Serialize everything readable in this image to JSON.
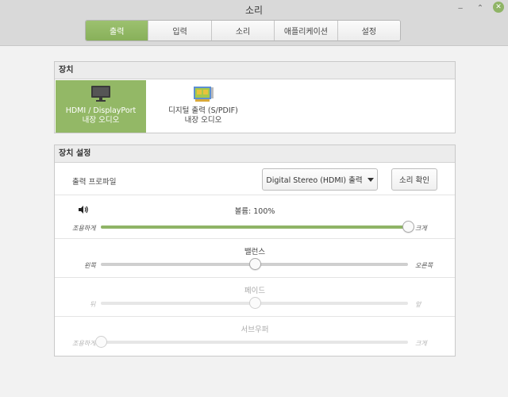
{
  "window": {
    "title": "소리",
    "minimize_glyph": "‒",
    "maximize_glyph": "⌃",
    "close_glyph": "✕"
  },
  "tabs": [
    {
      "label": "출력",
      "active": true
    },
    {
      "label": "입력",
      "active": false
    },
    {
      "label": "소리",
      "active": false
    },
    {
      "label": "애플리케이션",
      "active": false
    },
    {
      "label": "설정",
      "active": false
    }
  ],
  "devices_section": {
    "title": "장치",
    "devices": [
      {
        "name": "HDMI / DisplayPort",
        "sub": "내장 오디오",
        "icon": "monitor-icon",
        "selected": true
      },
      {
        "name": "디지털 출력 (S/PDIF)",
        "sub": "내장 오디오",
        "icon": "sound-card-icon",
        "selected": false
      }
    ]
  },
  "settings_section": {
    "title": "장치 설정",
    "profile_label": "출력 프로파일",
    "profile_value": "Digital Stereo (HDMI) 출력",
    "test_button": "소리 확인",
    "volume": {
      "title": "볼륨: 100%",
      "min_label": "조용하게",
      "max_label": "크게",
      "level": 1.0,
      "icon": "speaker-icon"
    },
    "balance": {
      "title": "밸런스",
      "min_label": "왼쪽",
      "max_label": "오른쪽",
      "level": 0.5
    },
    "fade": {
      "title": "페이드",
      "min_label": "뒤",
      "max_label": "앞",
      "level": 0.5,
      "enabled": false
    },
    "subwoofer": {
      "title": "서브우퍼",
      "min_label": "조용하게",
      "max_label": "크게",
      "level": 0.0,
      "enabled": false
    }
  },
  "colors": {
    "accent": "#8fb466",
    "header_bg": "#d9d9d9"
  }
}
